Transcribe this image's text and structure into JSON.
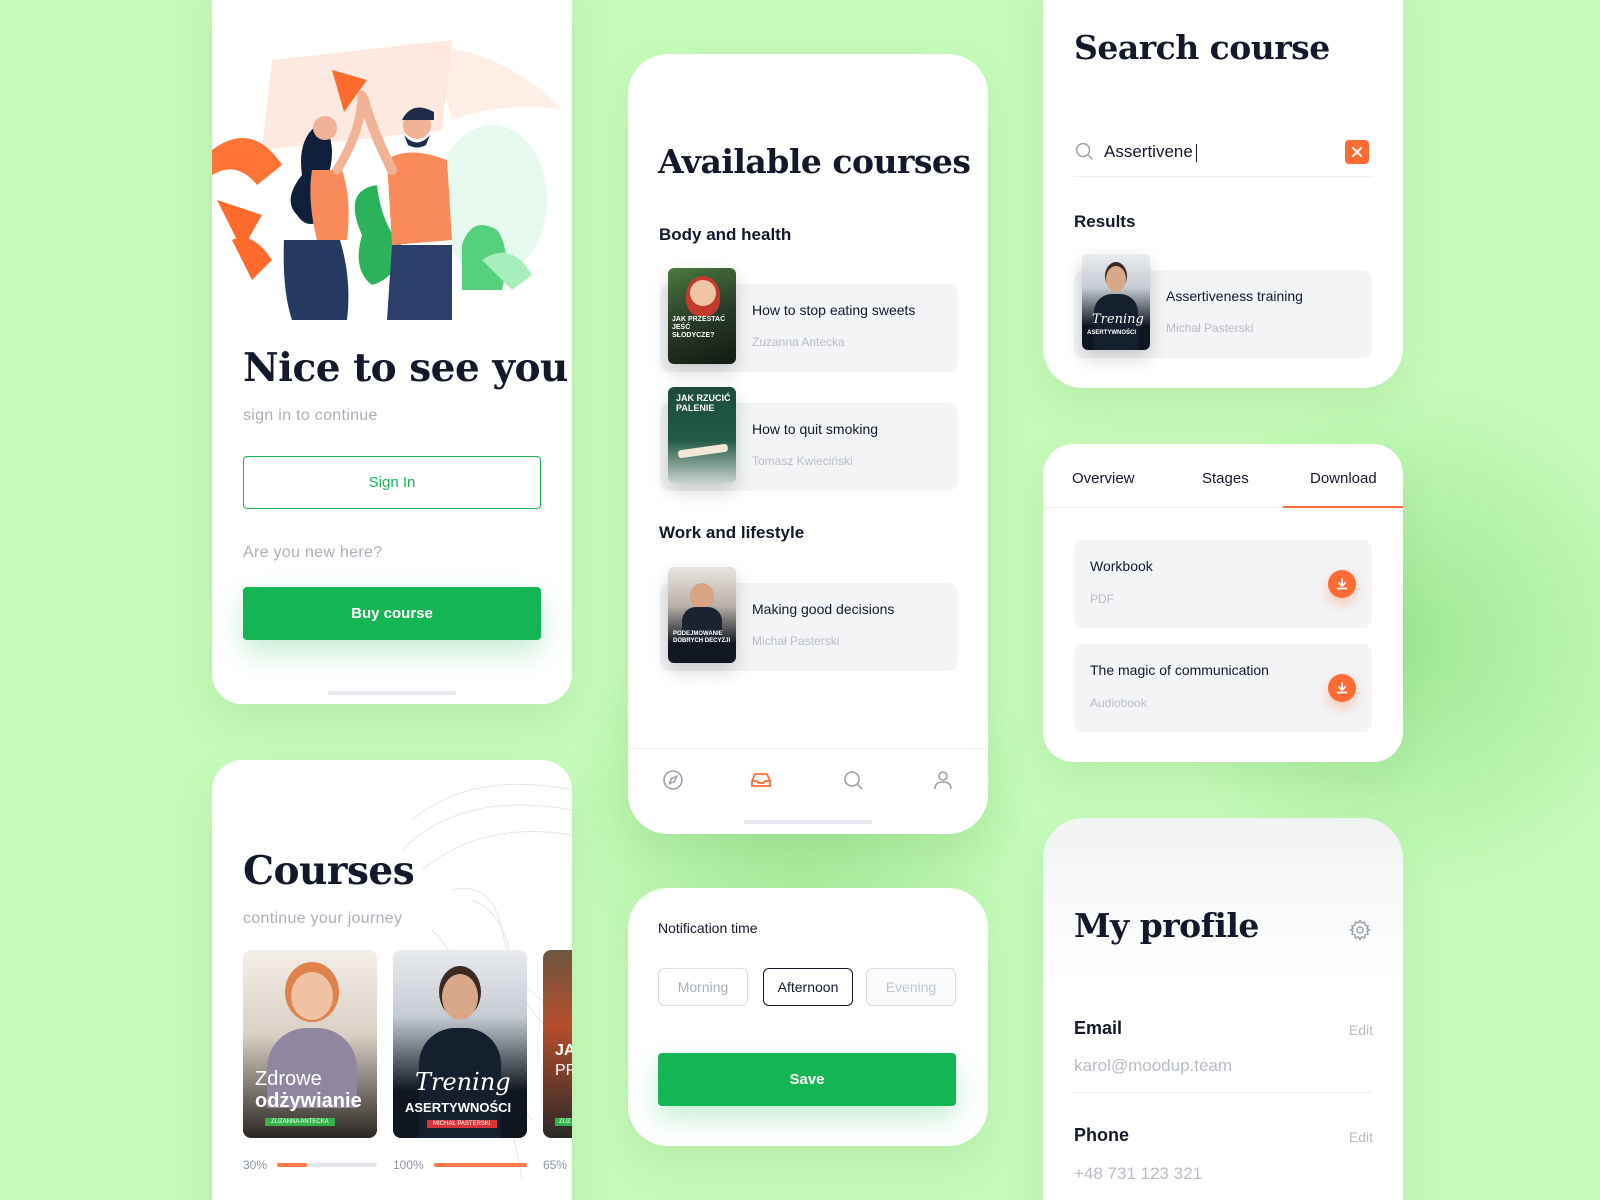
{
  "login": {
    "title": "Nice to see you",
    "subtitle": "sign in to continue",
    "sign_in_label": "Sign In",
    "new_here": "Are you new here?",
    "buy_label": "Buy course"
  },
  "available": {
    "title": "Available courses",
    "sections": [
      {
        "heading": "Body and health",
        "courses": [
          {
            "title": "How to stop eating sweets",
            "author": "Zuzanna Antecka",
            "cover_text": "JAK PRZESTAĆ JEŚĆ SŁODYCZE?"
          },
          {
            "title": "How to quit smoking",
            "author": "Tomasz Kwieciński",
            "cover_text": "JAK RZUCIĆ PALENIE"
          }
        ]
      },
      {
        "heading": "Work and lifestyle",
        "courses": [
          {
            "title": "Making good decisions",
            "author": "Michał Pasterski",
            "cover_text": "PODEJMOWANIE DOBRYCH DECYZJI"
          }
        ]
      }
    ],
    "nav": [
      "compass-icon",
      "inbox-icon",
      "search-icon",
      "user-icon"
    ],
    "active_nav": "inbox-icon"
  },
  "notification": {
    "label": "Notification time",
    "options": [
      "Morning",
      "Afternoon",
      "Evening"
    ],
    "selected": "Afternoon",
    "save_label": "Save"
  },
  "courses": {
    "title": "Courses",
    "subtitle": "continue your journey",
    "items": [
      {
        "title_line1": "Zdrowe",
        "title_line2": "odżywianie",
        "author": "ZUZANNA ANTECKA",
        "progress_label": "30%",
        "progress": 0.3
      },
      {
        "title_line1": "Trening",
        "title_line2": "ASERTYWNOŚCI",
        "author": "MICHAŁ PASTERSKI",
        "progress_label": "100%",
        "progress": 1.0
      },
      {
        "title_line1": "JA",
        "title_line2": "PR",
        "author": "ZUZ",
        "progress_label": "65%",
        "progress": 0.65
      }
    ]
  },
  "search": {
    "title": "Search course",
    "query": "Assertivene",
    "results_heading": "Results",
    "result": {
      "title": "Assertiveness training",
      "author": "Michał Pasterski",
      "cover_line1": "Trening",
      "cover_line2": "ASERTYWNOŚCI"
    }
  },
  "download": {
    "tabs": [
      "Overview",
      "Stages",
      "Download"
    ],
    "active_tab": "Download",
    "items": [
      {
        "title": "Workbook",
        "type": "PDF"
      },
      {
        "title": "The magic of communication",
        "type": "Audiobook"
      }
    ]
  },
  "profile": {
    "title": "My profile",
    "email_label": "Email",
    "email_value": "karol@moodup.team",
    "phone_label": "Phone",
    "phone_value": "+48 731 123 321",
    "edit_label": "Edit"
  },
  "colors": {
    "background": "#c5fbb9",
    "primary_green": "#14b653",
    "accent_orange": "#ff6b35",
    "text_dark": "#13192b"
  }
}
